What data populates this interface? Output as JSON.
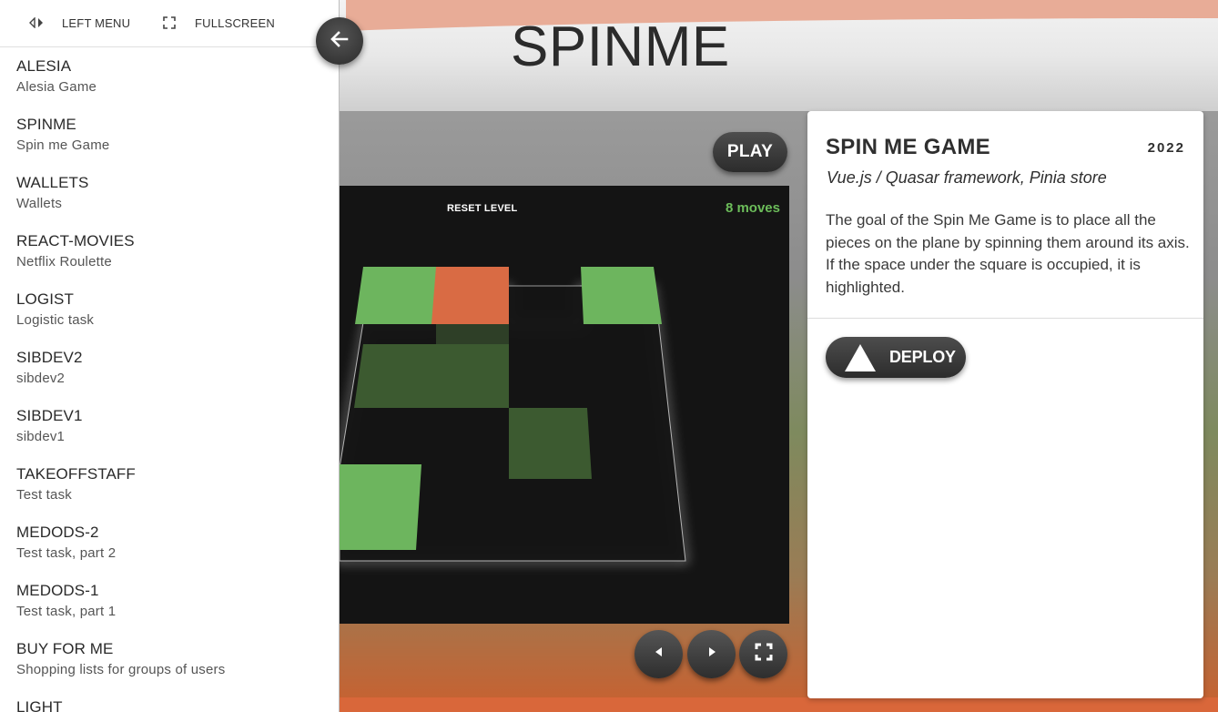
{
  "drawer": {
    "left_menu_label": "LEFT MENU",
    "fullscreen_label": "FULLSCREEN",
    "items": [
      {
        "title": "ALESIA",
        "subtitle": "Alesia Game"
      },
      {
        "title": "SPINME",
        "subtitle": "Spin me Game"
      },
      {
        "title": "WALLETS",
        "subtitle": "Wallets"
      },
      {
        "title": "REACT-MOVIES",
        "subtitle": "Netflix Roulette"
      },
      {
        "title": "LOGIST",
        "subtitle": "Logistic task"
      },
      {
        "title": "SIBDEV2",
        "subtitle": "sibdev2"
      },
      {
        "title": "SIBDEV1",
        "subtitle": "sibdev1"
      },
      {
        "title": "TAKEOFFSTAFF",
        "subtitle": "Test task"
      },
      {
        "title": "MEDODS-2",
        "subtitle": "Test task, part 2"
      },
      {
        "title": "MEDODS-1",
        "subtitle": "Test task, part 1"
      },
      {
        "title": "BUY FOR ME",
        "subtitle": "Shopping lists for groups of users"
      },
      {
        "title": "LIGHT",
        "subtitle": ""
      }
    ]
  },
  "page": {
    "title": "SPINME"
  },
  "game": {
    "play_label": "PLAY",
    "reset_label": "RESET LEVEL",
    "moves_label": "8 moves",
    "colors": {
      "board": "#141414",
      "piece": "#6db55e",
      "piece_dark": "#3c5a30",
      "highlight": "#d96b44",
      "moves": "#6cbd5a"
    }
  },
  "card": {
    "title": "SPIN ME GAME",
    "year": "2022",
    "subtitle": "Vue.js / Quasar framework, Pinia store",
    "description": "The goal of the Spin Me Game is to place all the pieces on the plane by spinning them around its axis. If the space under the square is occupied, it is highlighted.",
    "deploy_label": "DEPLOY"
  },
  "icons": {
    "back": "arrow-left-icon",
    "left_menu": "code-arrows-icon",
    "fullscreen": "fullscreen-icon",
    "prev": "caret-left-icon",
    "next": "caret-right-icon",
    "deploy": "triangle-logo-icon"
  }
}
